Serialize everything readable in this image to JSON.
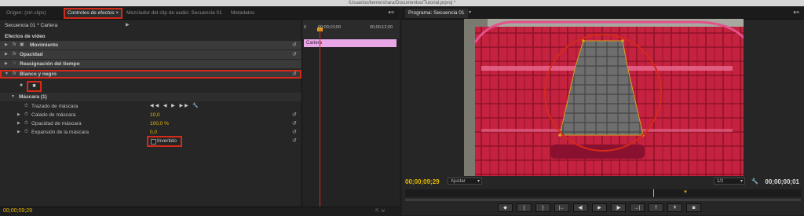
{
  "window": {
    "path": "/Usuarios/kemerchara/Documentos/Tutorial.prproj *"
  },
  "left_panel": {
    "tabs": [
      {
        "label": "Origen: (sin clips)"
      },
      {
        "label": "Controles de efectos ×"
      },
      {
        "label": "Mezclador del clip de audio: Secuencia 01"
      },
      {
        "label": "Metadatos"
      }
    ],
    "header": "Secuencia 01 * Cartera",
    "section_label": "Efectos de vídeo",
    "ruler": {
      "t0": "0",
      "t1": "00;00;10;00",
      "t2": "00;00;12;00"
    },
    "clip_name": "Cartera",
    "effects": [
      {
        "label": "Movimiento"
      },
      {
        "label": "Opacidad"
      },
      {
        "label": "Reasignación del tiempo"
      },
      {
        "label": "Blanco y negro"
      }
    ],
    "mask": {
      "label": "Máscara (1)",
      "path_label": "Trazado de máscara",
      "feather_label": "Calado de máscara",
      "feather_value": "10,0",
      "opacity_label": "Opacidad de máscara",
      "opacity_value": "100,0 %",
      "expansion_label": "Expansión de la máscara",
      "expansion_value": "0,0",
      "inverted_label": "Invertido"
    },
    "timecode": "00;00;09;29"
  },
  "right_panel": {
    "tab": "Programa: Secuencia 01",
    "timecode_left": "00;00;09;29",
    "fit": "Ajustar",
    "ratio": "1/2",
    "timecode_right": "00;00;00;01"
  }
}
